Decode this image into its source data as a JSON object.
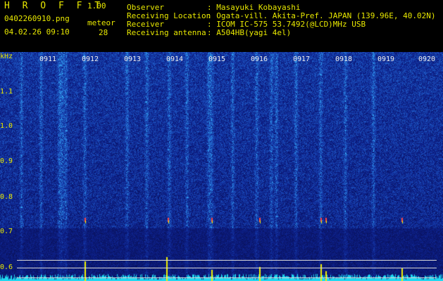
{
  "header": {
    "title": "H R O F F T",
    "version": "1.00",
    "filename": "0402260910.png",
    "datetime": "04.02.26 09:10",
    "meteor_label": "meteor",
    "meteor_count": "28",
    "info": [
      {
        "key": "Observer",
        "value": ": Masayuki Kobayashi"
      },
      {
        "key": "Receiving Location",
        "value": ": Ogata-vill. Akita-Pref. JAPAN (139.96E, 40.02N)"
      },
      {
        "key": "Receiver",
        "value": ": ICOM IC-575 53.7492(@LCD)MHz USB"
      },
      {
        "key": "Receiving antenna",
        "value": ": A504HB(yagi 4el)"
      }
    ]
  },
  "spectrogram": {
    "freq_unit": "kHz",
    "freq_labels": [
      "1.1",
      "1.0",
      "0.9",
      "0.8",
      "0.7",
      "0.6"
    ],
    "time_labels": [
      "0911",
      "0912",
      "0913",
      "0914",
      "0915",
      "0916",
      "0917",
      "0918",
      "0919",
      "0920"
    ],
    "colors": {
      "background": "#000000",
      "noise_low": "#0a1a8a",
      "noise_high": "#3a9aff",
      "echo": "#e8e800"
    }
  }
}
